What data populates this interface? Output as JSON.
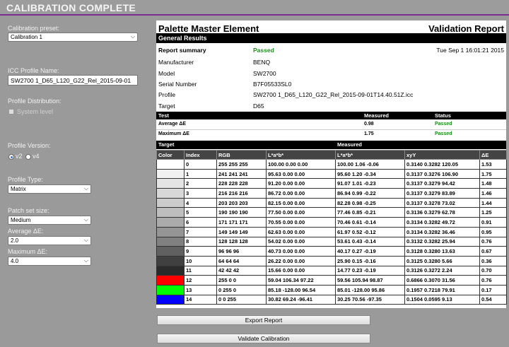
{
  "header": {
    "title": "CALIBRATION COMPLETE"
  },
  "left": {
    "preset_label": "Calibration preset:",
    "preset_value": "Calibration 1",
    "icc_label": "ICC Profile Name:",
    "icc_value": "SW2700 1_D65_L120_G22_Rel_2015-09-01",
    "distribution_label": "Profile Distribution:",
    "system_level_label": "System level",
    "version_label": "Profile Version:",
    "v2_label": "v2",
    "v4_label": "v4",
    "type_label": "Profile Type:",
    "type_value": "Matrix",
    "patch_label": "Patch set size:",
    "patch_value": "Medium",
    "avg_label": "Average ΔE:",
    "avg_value": "2.0",
    "max_label": "Maximum ΔE:",
    "max_value": "4.0"
  },
  "report": {
    "title_left": "Palette Master Element",
    "title_right": "Validation Report",
    "general_results": "General Results",
    "summary_label": "Report summary",
    "summary_value": "Passed",
    "date": "Tue Sep 1 16:01:21 2015",
    "manufacturer_label": "Manufacturer",
    "manufacturer_value": "BENQ",
    "model_label": "Model",
    "model_value": "SW2700",
    "serial_label": "Serial Number",
    "serial_value": "B7F05533SL0",
    "profile_label": "Profile",
    "profile_value": "SW2700 1_D65_L120_G22_Rel_2015-09-01T14.40.51Z.icc",
    "target_label": "Target",
    "target_value": "D65",
    "test_headers": {
      "test": "Test",
      "measured": "Measured",
      "status": "Status"
    },
    "tests": [
      {
        "name": "Average ΔE",
        "measured": "0.98",
        "status": "Passed"
      },
      {
        "name": "Maximum ΔE",
        "measured": "1.75",
        "status": "Passed"
      }
    ],
    "group_headers": {
      "target": "Target",
      "measured": "Measured"
    },
    "columns": [
      "Color",
      "Index",
      "RGB",
      "L*a*b*",
      "L*a*b*",
      "xyY",
      "ΔE"
    ],
    "rows": [
      {
        "color": "#ffffff",
        "index": "0",
        "rgb": "255  255  255",
        "target_lab": "100.00  0.00  0.00",
        "measured_lab": "100.00  1.06  -0.06",
        "xyy": "0.3140  0.3282  120.05",
        "de": "1.53"
      },
      {
        "color": "#f1f1f1",
        "index": "1",
        "rgb": "241  241  241",
        "target_lab": "95.63  0.00  0.00",
        "measured_lab": "95.60  1.20  -0.34",
        "xyy": "0.3137  0.3276  106.90",
        "de": "1.75"
      },
      {
        "color": "#e4e4e4",
        "index": "2",
        "rgb": "228  228  228",
        "target_lab": "91.20  0.00  0.00",
        "measured_lab": "91.07  1.01  -0.23",
        "xyy": "0.3137  0.3279  94.42",
        "de": "1.48"
      },
      {
        "color": "#d8d8d8",
        "index": "3",
        "rgb": "216  216  216",
        "target_lab": "86.72  0.00  0.00",
        "measured_lab": "86.94  0.99  -0.22",
        "xyy": "0.3137  0.3279  83.89",
        "de": "1.46"
      },
      {
        "color": "#cbcbcb",
        "index": "4",
        "rgb": "203  203  203",
        "target_lab": "82.15  0.00  0.00",
        "measured_lab": "82.28  0.98  -0.25",
        "xyy": "0.3137  0.3278  73.02",
        "de": "1.44"
      },
      {
        "color": "#bebebe",
        "index": "5",
        "rgb": "190  190  190",
        "target_lab": "77.50  0.00  0.00",
        "measured_lab": "77.46  0.85  -0.21",
        "xyy": "0.3136  0.3279  62.78",
        "de": "1.25"
      },
      {
        "color": "#ababab",
        "index": "6",
        "rgb": "171  171  171",
        "target_lab": "70.55  0.00  0.00",
        "measured_lab": "70.46  0.61  -0.14",
        "xyy": "0.3134  0.3282  49.72",
        "de": "0.91"
      },
      {
        "color": "#959595",
        "index": "7",
        "rgb": "149  149  149",
        "target_lab": "62.63  0.00  0.00",
        "measured_lab": "61.97  0.52  -0.12",
        "xyy": "0.3134  0.3282  36.46",
        "de": "0.95"
      },
      {
        "color": "#808080",
        "index": "8",
        "rgb": "128  128  128",
        "target_lab": "54.02  0.00  0.00",
        "measured_lab": "53.61  0.43  -0.14",
        "xyy": "0.3132  0.3282  25.94",
        "de": "0.76"
      },
      {
        "color": "#606060",
        "index": "9",
        "rgb": "96  96  96",
        "target_lab": "40.73  0.00  0.00",
        "measured_lab": "40.17  0.27  -0.19",
        "xyy": "0.3128  0.3280  13.63",
        "de": "0.67"
      },
      {
        "color": "#404040",
        "index": "10",
        "rgb": "64  64  64",
        "target_lab": "26.22  0.00  0.00",
        "measured_lab": "25.90  0.15  -0.16",
        "xyy": "0.3125  0.3280  5.66",
        "de": "0.36"
      },
      {
        "color": "#2a2a2a",
        "index": "11",
        "rgb": "42  42  42",
        "target_lab": "15.66  0.00  0.00",
        "measured_lab": "14.77  0.23  -0.19",
        "xyy": "0.3126  0.3272  2.24",
        "de": "0.70"
      },
      {
        "color": "#ff0000",
        "index": "12",
        "rgb": "255  0  0",
        "target_lab": "59.04  106.34  97.22",
        "measured_lab": "59.56  105.94  98.87",
        "xyy": "0.6866  0.3070  31.56",
        "de": "0.76"
      },
      {
        "color": "#00ff00",
        "index": "13",
        "rgb": "0  255  0",
        "target_lab": "85.18  -128.00  96.54",
        "measured_lab": "85.01  -128.00  95.86",
        "xyy": "0.1957  0.7218  79.91",
        "de": "0.17"
      },
      {
        "color": "#0000ff",
        "index": "14",
        "rgb": "0  0  255",
        "target_lab": "30.82  69.24  -96.41",
        "measured_lab": "30.25  70.56  -97.35",
        "xyy": "0.1504  0.0595  9.13",
        "de": "0.54"
      }
    ]
  },
  "actions": {
    "export_label": "Export Report",
    "validate_label": "Validate Calibration"
  }
}
